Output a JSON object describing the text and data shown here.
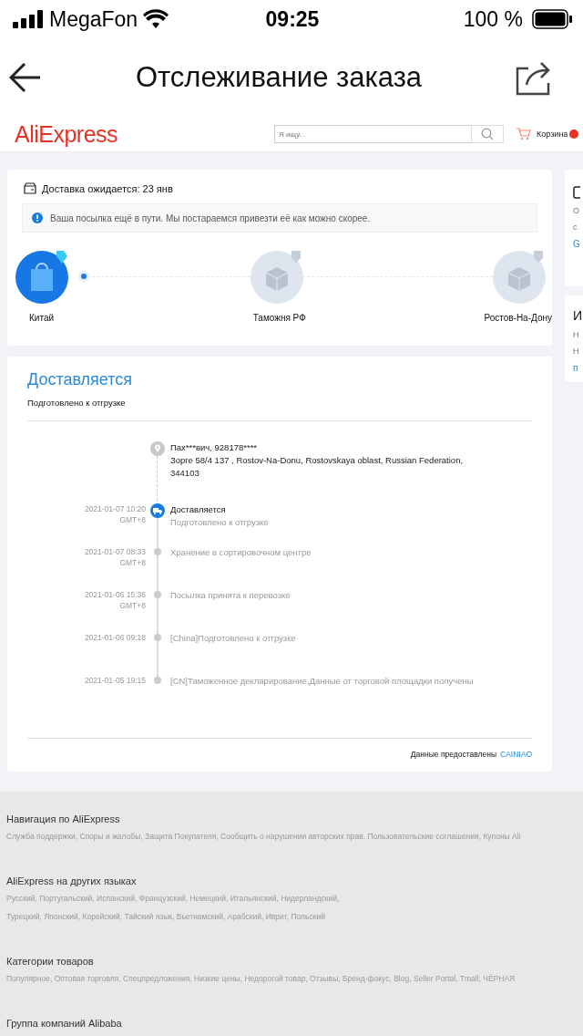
{
  "status_bar": {
    "carrier": "MegaFon",
    "time": "09:25",
    "battery": "100 %"
  },
  "nav": {
    "title": "Отслеживание заказа"
  },
  "site_header": {
    "logo": "AliExpress",
    "search": {
      "placeholder": "Я ищу..."
    },
    "cart": "Корзина"
  },
  "delivery_card": {
    "expected": "Доставка ожидается: 23 янв",
    "notice": "Ваша посылка ещё в пути. Мы постараемся привезти её как можно скорее.",
    "steps": [
      {
        "label": "Китай",
        "active": true
      },
      {
        "label": "Таможня РФ",
        "active": false
      },
      {
        "label": "Ростов-На-Дону",
        "active": false
      }
    ]
  },
  "tracking_card": {
    "status": "Доставляется",
    "substatus": "Подготовлено к отгрузке",
    "events": [
      {
        "kind": "address",
        "title": "Пах***вич,  928178****",
        "detail": "Зорге 58/4 137 ,  Rostov-Na-Donu,  Rostovskaya oblast,  Russian Federation,  344103"
      },
      {
        "kind": "current",
        "date": "2021-01-07 10:20",
        "zone": "GMT+8",
        "title": "Доставляется",
        "detail": "Подготовлено к отгрузке"
      },
      {
        "kind": "past",
        "date": "2021-01-07 08:33",
        "zone": "GMT+8",
        "title": "Хранение в сортировочном центре"
      },
      {
        "kind": "past",
        "date": "2021-01-06 15:36",
        "zone": "GMT+8",
        "title": "Посылка принята к перевозке"
      },
      {
        "kind": "past",
        "date": "2021-01-06 09:18",
        "title": "[China]Подготовлено к отгрузке"
      },
      {
        "kind": "past",
        "date": "2021-01-05 19:15",
        "title": "[CN]Таможенное декларирование,Данные от торговой площадки получены"
      }
    ],
    "source_label": "Данные предоставлены",
    "source_link": "CAINIAO"
  },
  "side_cards": [
    {
      "lines": [
        {
          "text": "О",
          "link": false
        },
        {
          "text": "с",
          "link": false
        },
        {
          "text": "G",
          "link": true
        }
      ],
      "icon": true
    },
    {
      "heading": "И",
      "lines": [
        {
          "text": "Н",
          "link": false
        },
        {
          "text": "Н",
          "link": false
        },
        {
          "text": "п",
          "link": true
        }
      ],
      "icon": false
    }
  ],
  "footer": [
    {
      "heading": "Навигация по AliExpress",
      "lines": [
        "Служба поддержки, Споры и жалобы, Защита Покупателя, Сообщить о нарушении авторских прав, Пользовательские соглашения, Купоны Ali"
      ]
    },
    {
      "heading": "AliExpress на других языках",
      "lines": [
        "Русский, Португальский, Испанский, Французский, Немецкий, Итальянский, Нидерландский,",
        "Турецкий, Японский, Корейский, Тайский язык, Вьетнамский, Арабский, Иврит, Польский"
      ]
    },
    {
      "heading": "Категории товаров",
      "lines": [
        "Популярное, Оптовая торговля, Спецпредложения, Низкие цены, Недорогой товар, Отзывы, Бренд-фокус, Blog, Seller Portal, Tmall, ЧЁРНАЯ"
      ]
    },
    {
      "heading": "Группа компаний Alibaba"
    }
  ]
}
